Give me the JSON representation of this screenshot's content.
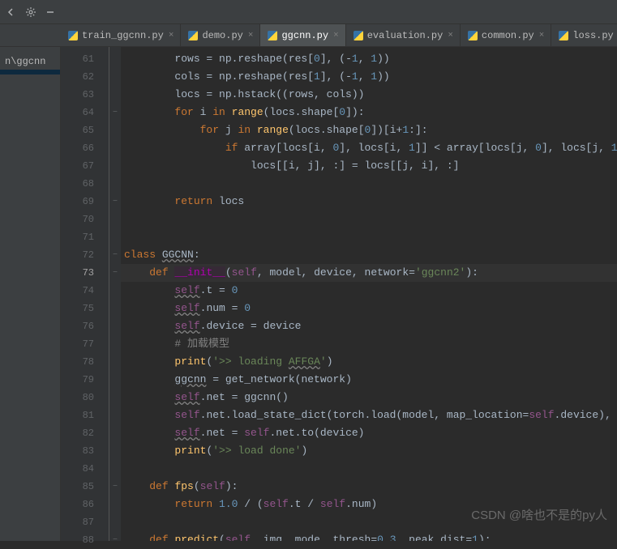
{
  "toolbar": {
    "icons": [
      "chevron-left",
      "gear",
      "minus"
    ]
  },
  "tabs": [
    {
      "label": "train_ggcnn.py",
      "active": false
    },
    {
      "label": "demo.py",
      "active": false
    },
    {
      "label": "ggcnn.py",
      "active": true
    },
    {
      "label": "evaluation.py",
      "active": false
    },
    {
      "label": "common.py",
      "active": false
    },
    {
      "label": "loss.py",
      "active": false
    }
  ],
  "sidebar": {
    "items": [
      {
        "label": "",
        "selected": false
      },
      {
        "label": "n\\ggcnn",
        "selected": false
      },
      {
        "label": "",
        "selected": true
      }
    ]
  },
  "gutter": {
    "start": 61,
    "end": 88,
    "current": 73
  },
  "fold_markers": {
    "64": "⊟",
    "69": "⊟",
    "72": "⊟",
    "73": "⊟",
    "85": "⊟",
    "88": "⊟"
  },
  "code": [
    {
      "n": 61,
      "tokens": [
        {
          "t": "        rows = np.reshape(res[",
          "c": ""
        },
        {
          "t": "0",
          "c": "num"
        },
        {
          "t": "], (-",
          "c": ""
        },
        {
          "t": "1",
          "c": "num"
        },
        {
          "t": ", ",
          "c": ""
        },
        {
          "t": "1",
          "c": "num"
        },
        {
          "t": "))",
          "c": ""
        }
      ]
    },
    {
      "n": 62,
      "tokens": [
        {
          "t": "        cols = np.reshape(res[",
          "c": ""
        },
        {
          "t": "1",
          "c": "num"
        },
        {
          "t": "], (-",
          "c": ""
        },
        {
          "t": "1",
          "c": "num"
        },
        {
          "t": ", ",
          "c": ""
        },
        {
          "t": "1",
          "c": "num"
        },
        {
          "t": "))",
          "c": ""
        }
      ]
    },
    {
      "n": 63,
      "tokens": [
        {
          "t": "        locs = np.hstack((rows, cols))",
          "c": ""
        }
      ]
    },
    {
      "n": 64,
      "tokens": [
        {
          "t": "        ",
          "c": ""
        },
        {
          "t": "for ",
          "c": "kw"
        },
        {
          "t": "i ",
          "c": ""
        },
        {
          "t": "in ",
          "c": "kw"
        },
        {
          "t": "range",
          "c": "fn"
        },
        {
          "t": "(locs.shape[",
          "c": ""
        },
        {
          "t": "0",
          "c": "num"
        },
        {
          "t": "]):",
          "c": ""
        }
      ]
    },
    {
      "n": 65,
      "tokens": [
        {
          "t": "            ",
          "c": ""
        },
        {
          "t": "for ",
          "c": "kw"
        },
        {
          "t": "j ",
          "c": ""
        },
        {
          "t": "in ",
          "c": "kw"
        },
        {
          "t": "range",
          "c": "fn"
        },
        {
          "t": "(locs.shape[",
          "c": ""
        },
        {
          "t": "0",
          "c": "num"
        },
        {
          "t": "])[i+",
          "c": ""
        },
        {
          "t": "1",
          "c": "num"
        },
        {
          "t": ":]:",
          "c": ""
        }
      ]
    },
    {
      "n": 66,
      "tokens": [
        {
          "t": "                ",
          "c": ""
        },
        {
          "t": "if ",
          "c": "kw"
        },
        {
          "t": "array[locs[i, ",
          "c": ""
        },
        {
          "t": "0",
          "c": "num"
        },
        {
          "t": "], locs[i, ",
          "c": ""
        },
        {
          "t": "1",
          "c": "num"
        },
        {
          "t": "]] < array[locs[j, ",
          "c": ""
        },
        {
          "t": "0",
          "c": "num"
        },
        {
          "t": "], locs[j, ",
          "c": ""
        },
        {
          "t": "1",
          "c": "num"
        },
        {
          "t": "]]:",
          "c": ""
        }
      ]
    },
    {
      "n": 67,
      "tokens": [
        {
          "t": "                    locs[[i, j], :] = locs[[j, i], :]",
          "c": ""
        }
      ]
    },
    {
      "n": 68,
      "tokens": []
    },
    {
      "n": 69,
      "tokens": [
        {
          "t": "        ",
          "c": ""
        },
        {
          "t": "return ",
          "c": "kw"
        },
        {
          "t": "locs",
          "c": ""
        }
      ]
    },
    {
      "n": 70,
      "tokens": []
    },
    {
      "n": 71,
      "tokens": []
    },
    {
      "n": 72,
      "tokens": [
        {
          "t": "class ",
          "c": "kw"
        },
        {
          "t": "GGCNN",
          "c": "cls und"
        },
        {
          "t": ":",
          "c": ""
        }
      ]
    },
    {
      "n": 73,
      "hl": true,
      "tokens": [
        {
          "t": "    ",
          "c": ""
        },
        {
          "t": "def ",
          "c": "def"
        },
        {
          "t": "__init__",
          "c": "dunder"
        },
        {
          "t": "(",
          "c": ""
        },
        {
          "t": "self",
          "c": "self"
        },
        {
          "t": ", model, device, ",
          "c": ""
        },
        {
          "t": "network",
          "c": "param"
        },
        {
          "t": "=",
          "c": ""
        },
        {
          "t": "'ggcnn2'",
          "c": "str"
        },
        {
          "t": "):",
          "c": ""
        }
      ]
    },
    {
      "n": 74,
      "tokens": [
        {
          "t": "        ",
          "c": ""
        },
        {
          "t": "self",
          "c": "self und"
        },
        {
          "t": ".t = ",
          "c": ""
        },
        {
          "t": "0",
          "c": "num"
        }
      ]
    },
    {
      "n": 75,
      "tokens": [
        {
          "t": "        ",
          "c": ""
        },
        {
          "t": "self",
          "c": "self und"
        },
        {
          "t": ".num = ",
          "c": ""
        },
        {
          "t": "0",
          "c": "num"
        }
      ]
    },
    {
      "n": 76,
      "tokens": [
        {
          "t": "        ",
          "c": ""
        },
        {
          "t": "self",
          "c": "self und"
        },
        {
          "t": ".device = device",
          "c": ""
        }
      ]
    },
    {
      "n": 77,
      "tokens": [
        {
          "t": "        ",
          "c": ""
        },
        {
          "t": "# 加载模型",
          "c": "cmt"
        }
      ]
    },
    {
      "n": 78,
      "tokens": [
        {
          "t": "        ",
          "c": ""
        },
        {
          "t": "print",
          "c": "fn"
        },
        {
          "t": "(",
          "c": ""
        },
        {
          "t": "'>> loading ",
          "c": "str"
        },
        {
          "t": "AFFGA",
          "c": "str und"
        },
        {
          "t": "'",
          "c": "str"
        },
        {
          "t": ")",
          "c": ""
        }
      ]
    },
    {
      "n": 79,
      "tokens": [
        {
          "t": "        ",
          "c": ""
        },
        {
          "t": "ggcnn",
          "c": "und"
        },
        {
          "t": " = get_network(network)",
          "c": ""
        }
      ]
    },
    {
      "n": 80,
      "tokens": [
        {
          "t": "        ",
          "c": ""
        },
        {
          "t": "self",
          "c": "self und"
        },
        {
          "t": ".net = ggcnn()",
          "c": ""
        }
      ]
    },
    {
      "n": 81,
      "tokens": [
        {
          "t": "        ",
          "c": ""
        },
        {
          "t": "self",
          "c": "self"
        },
        {
          "t": ".net.load_state_dict(torch.load(model, ",
          "c": ""
        },
        {
          "t": "map_location",
          "c": "param"
        },
        {
          "t": "=",
          "c": ""
        },
        {
          "t": "self",
          "c": "self"
        },
        {
          "t": ".device),",
          "c": ""
        }
      ]
    },
    {
      "n": 82,
      "tokens": [
        {
          "t": "        ",
          "c": ""
        },
        {
          "t": "self",
          "c": "self und"
        },
        {
          "t": ".net = ",
          "c": ""
        },
        {
          "t": "self",
          "c": "self"
        },
        {
          "t": ".net.to(device)",
          "c": ""
        }
      ]
    },
    {
      "n": 83,
      "tokens": [
        {
          "t": "        ",
          "c": ""
        },
        {
          "t": "print",
          "c": "fn"
        },
        {
          "t": "(",
          "c": ""
        },
        {
          "t": "'>> load done'",
          "c": "str"
        },
        {
          "t": ")",
          "c": ""
        }
      ]
    },
    {
      "n": 84,
      "tokens": []
    },
    {
      "n": 85,
      "tokens": [
        {
          "t": "    ",
          "c": ""
        },
        {
          "t": "def ",
          "c": "def"
        },
        {
          "t": "fps",
          "c": "fn"
        },
        {
          "t": "(",
          "c": ""
        },
        {
          "t": "self",
          "c": "self"
        },
        {
          "t": "):",
          "c": ""
        }
      ]
    },
    {
      "n": 86,
      "tokens": [
        {
          "t": "        ",
          "c": ""
        },
        {
          "t": "return ",
          "c": "kw"
        },
        {
          "t": "1.0 ",
          "c": "num"
        },
        {
          "t": "/ (",
          "c": ""
        },
        {
          "t": "self",
          "c": "self"
        },
        {
          "t": ".t / ",
          "c": ""
        },
        {
          "t": "self",
          "c": "self"
        },
        {
          "t": ".num)",
          "c": ""
        }
      ]
    },
    {
      "n": 87,
      "tokens": []
    },
    {
      "n": 88,
      "tokens": [
        {
          "t": "    ",
          "c": ""
        },
        {
          "t": "def ",
          "c": "def"
        },
        {
          "t": "predict",
          "c": "fn"
        },
        {
          "t": "(",
          "c": ""
        },
        {
          "t": "self",
          "c": "self"
        },
        {
          "t": ", img, mode, ",
          "c": ""
        },
        {
          "t": "thresh",
          "c": "param"
        },
        {
          "t": "=",
          "c": ""
        },
        {
          "t": "0.3",
          "c": "num"
        },
        {
          "t": ", ",
          "c": ""
        },
        {
          "t": "peak_dist",
          "c": "param"
        },
        {
          "t": "=",
          "c": ""
        },
        {
          "t": "1",
          "c": "num"
        },
        {
          "t": "):",
          "c": ""
        }
      ]
    }
  ],
  "watermark": "CSDN @啥也不是的py人"
}
